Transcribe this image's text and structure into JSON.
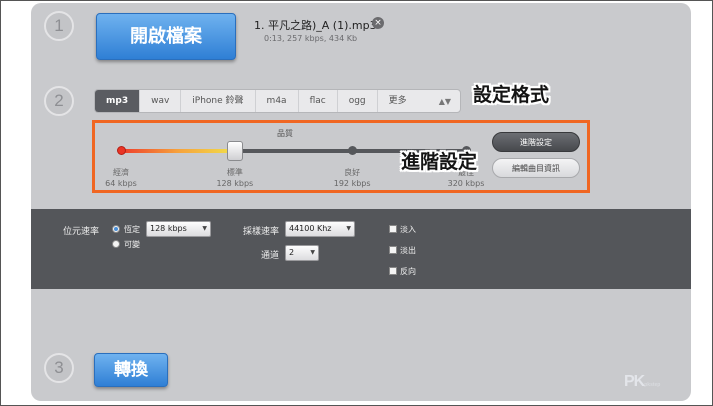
{
  "steps": {
    "step1": "1",
    "step2": "2",
    "step3": "3"
  },
  "file": {
    "open_button": "開啟檔案",
    "name": "1. 平凡之路)_A (1).mp3",
    "meta": "0:13, 257 kbps, 434 Kb",
    "remove_glyph": "×"
  },
  "format": {
    "tabs": [
      "mp3",
      "wav",
      "iPhone 鈴聲",
      "m4a",
      "flac",
      "ogg",
      "更多"
    ],
    "active_tab": "mp3",
    "arrows_glyph": "▲▼"
  },
  "annotations": {
    "format": "設定格式",
    "advanced": "進階設定"
  },
  "quality": {
    "title": "品質",
    "level_percent": 33,
    "labels": [
      {
        "name": "經濟",
        "rate": "64 kbps"
      },
      {
        "name": "標準",
        "rate": "128 kbps"
      },
      {
        "name": "良好",
        "rate": "192 kbps"
      },
      {
        "name": "最佳",
        "rate": "320 kbps"
      }
    ],
    "advanced_button": "進階設定",
    "edit_info_button": "編輯曲目資訊"
  },
  "advanced": {
    "bitrate_label": "位元速率",
    "bitrate_mode_fixed": "恆定",
    "bitrate_mode_variable": "可變",
    "bitrate_value": "128 kbps",
    "sample_rate_label": "採樣速率",
    "sample_rate_value": "44100 Khz",
    "channels_label": "通道",
    "channels_value": "2",
    "fade_in": "淡入",
    "fade_out": "淡出",
    "reverse": "反向"
  },
  "convert_button": "轉換",
  "watermark": {
    "main": "PK",
    "small": "pkstep"
  },
  "colors": {
    "accent_blue": "#2f7fd5",
    "annotation_orange": "#f06622",
    "panel_dark": "#54565a",
    "slider_red": "#ea3425"
  }
}
